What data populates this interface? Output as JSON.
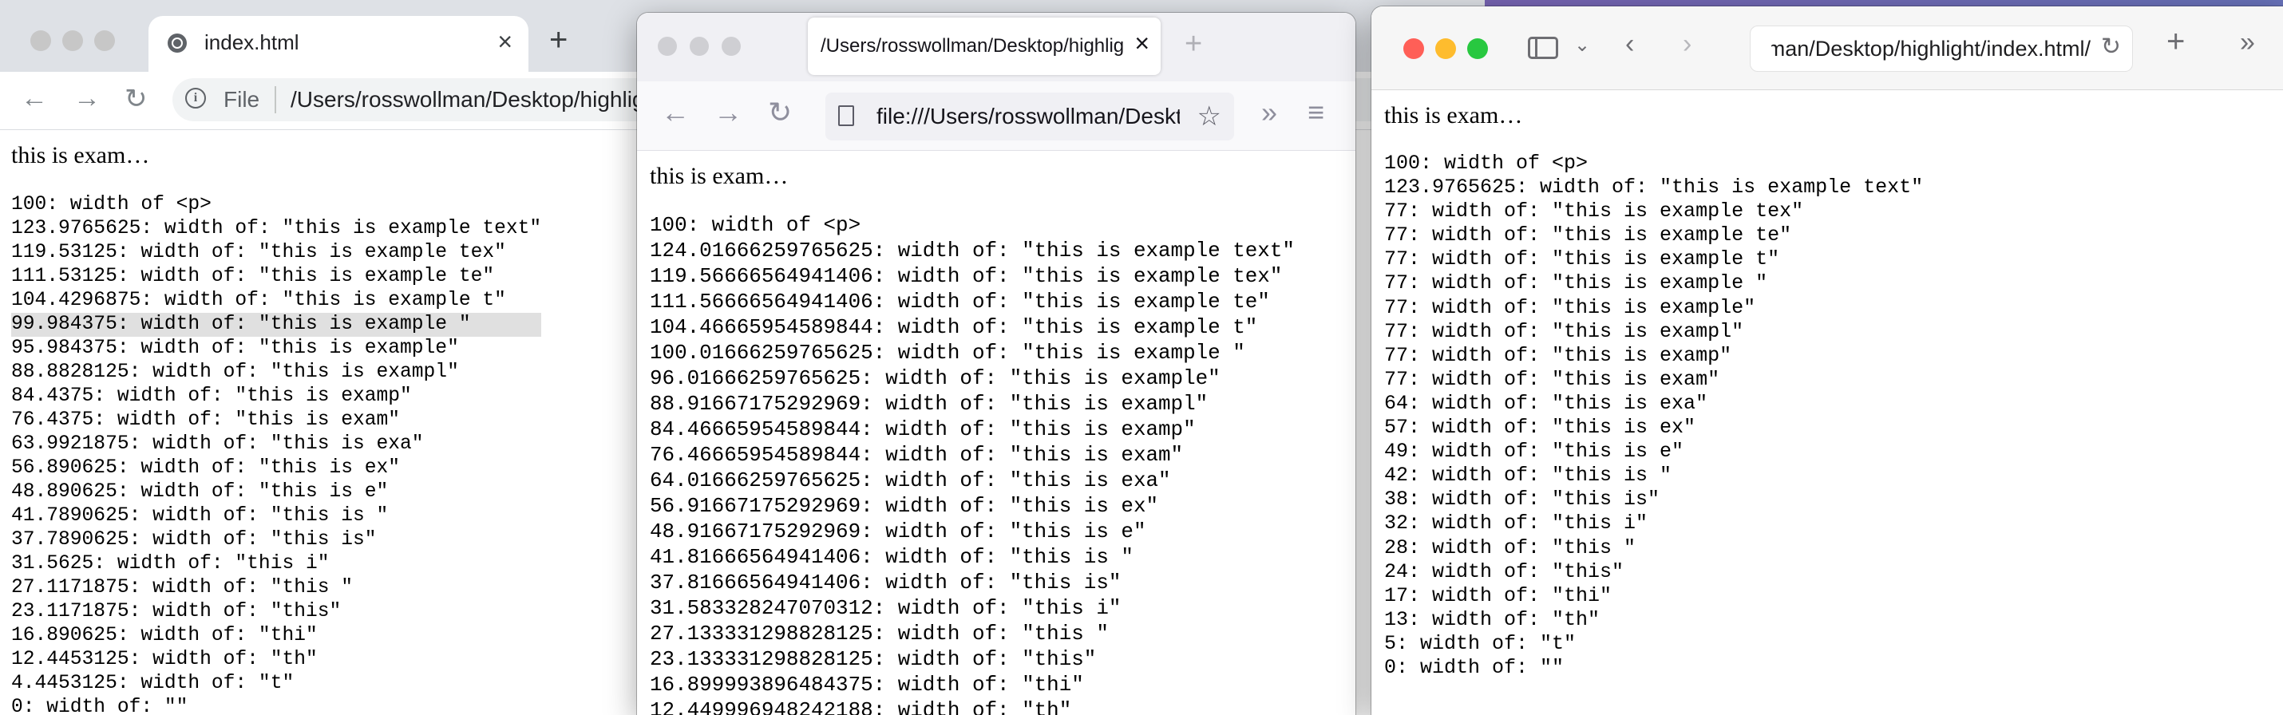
{
  "chrome": {
    "tab_title": "index.html",
    "omnibox_label": "File",
    "url": "/Users/rosswollman/Desktop/highlight/index.html",
    "heading": "this is exam…",
    "lines": [
      "100: width of <p>",
      "123.9765625: width of: \"this is example text\"",
      "119.53125: width of: \"this is example tex\"",
      "111.53125: width of: \"this is example te\"",
      "104.4296875: width of: \"this is example t\"",
      "99.984375: width of: \"this is example \"",
      "95.984375: width of: \"this is example\"",
      "88.8828125: width of: \"this is exampl\"",
      "84.4375: width of: \"this is examp\"",
      "76.4375: width of: \"this is exam\"",
      "63.9921875: width of: \"this is exa\"",
      "56.890625: width of: \"this is ex\"",
      "48.890625: width of: \"this is e\"",
      "41.7890625: width of: \"this is \"",
      "37.7890625: width of: \"this is\"",
      "31.5625: width of: \"this i\"",
      "27.1171875: width of: \"this \"",
      "23.1171875: width of: \"this\"",
      "16.890625: width of: \"thi\"",
      "12.4453125: width of: \"th\"",
      "4.4453125: width of: \"t\"",
      "0: width of: \"\""
    ],
    "highlighted_line": 5
  },
  "firefox": {
    "tab_title": "/Users/rosswollman/Desktop/highlight/index.html",
    "url": "file:///Users/rosswollman/Desktop/highlight/index.html",
    "heading": "this is exam…",
    "lines": [
      "100: width of <p>",
      "124.01666259765625: width of: \"this is example text\"",
      "119.56666564941406: width of: \"this is example tex\"",
      "111.56666564941406: width of: \"this is example te\"",
      "104.46665954589844: width of: \"this is example t\"",
      "100.01666259765625: width of: \"this is example \"",
      "96.01666259765625: width of: \"this is example\"",
      "88.91667175292969: width of: \"this is exampl\"",
      "84.46665954589844: width of: \"this is examp\"",
      "76.46665954589844: width of: \"this is exam\"",
      "64.01666259765625: width of: \"this is exa\"",
      "56.91667175292969: width of: \"this is ex\"",
      "48.91667175292969: width of: \"this is e\"",
      "41.81666564941406: width of: \"this is \"",
      "37.81666564941406: width of: \"this is\"",
      "31.583328247070312: width of: \"this i\"",
      "27.133331298828125: width of: \"this \"",
      "23.133331298828125: width of: \"this\"",
      "16.899993896484375: width of: \"thi\"",
      "12.449996948242188: width of: \"th\""
    ]
  },
  "safari": {
    "url": "/Users/rosswollman/Desktop/highlight/index.html",
    "heading": "this is exam…",
    "lines": [
      "100: width of <p>",
      "123.9765625: width of: \"this is example text\"",
      "77: width of: \"this is example tex\"",
      "77: width of: \"this is example te\"",
      "77: width of: \"this is example t\"",
      "77: width of: \"this is example \"",
      "77: width of: \"this is example\"",
      "77: width of: \"this is exampl\"",
      "77: width of: \"this is examp\"",
      "77: width of: \"this is exam\"",
      "64: width of: \"this is exa\"",
      "57: width of: \"this is ex\"",
      "49: width of: \"this is e\"",
      "42: width of: \"this is \"",
      "38: width of: \"this is\"",
      "32: width of: \"this i\"",
      "28: width of: \"this \"",
      "24: width of: \"this\"",
      "17: width of: \"thi\"",
      "13: width of: \"th\"",
      "5: width of: \"t\"",
      "0: width of: \"\""
    ]
  },
  "colors": {
    "mac_close": "#ff5f57",
    "mac_minimize": "#febc2e",
    "mac_zoom": "#28c840",
    "inactive_light": "#c7c7c7",
    "chrome_tabstrip": "#dee1e6",
    "firefox_tabstrip": "#f0f0f4",
    "selection_highlight": "#e0e0e0"
  },
  "icons": {
    "chrome": [
      "globe-icon",
      "close-icon",
      "new-tab-icon",
      "back-icon",
      "forward-icon",
      "reload-icon",
      "info-icon"
    ],
    "firefox": [
      "close-icon",
      "new-tab-icon",
      "back-icon",
      "forward-icon",
      "reload-icon",
      "page-icon",
      "bookmark-star-icon",
      "overflow-chevrons-icon",
      "menu-icon"
    ],
    "safari": [
      "sidebar-icon",
      "chevron-down-icon",
      "back-icon",
      "forward-icon",
      "reload-icon",
      "new-tab-icon",
      "overflow-chevrons-icon"
    ]
  }
}
